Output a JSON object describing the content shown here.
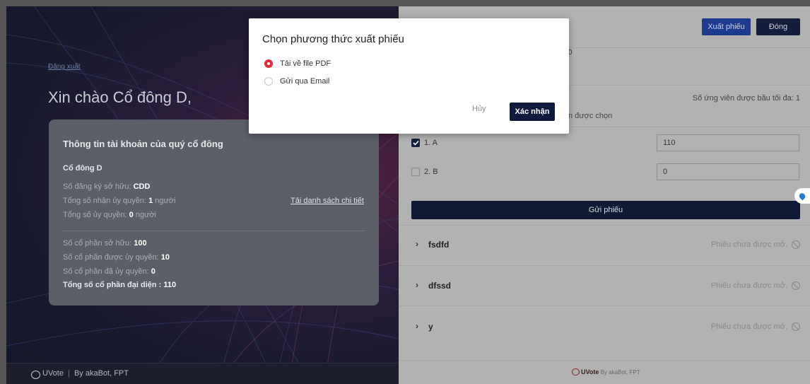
{
  "left_panel": {
    "logout": "Đăng xuất",
    "greeting": "Xin chào Cổ đông D,",
    "card": {
      "title": "Thông tin tài khoản của quý cổ đông",
      "shareholder_name": "Cổ đông D",
      "registration": {
        "label": "Số đăng ký sở hữu: ",
        "value": "CDD"
      },
      "received_proxies": {
        "label": "Tổng số nhận ủy quyền: ",
        "value": "1",
        "unit": " người"
      },
      "given_proxies": {
        "label": "Tổng số ủy quyền: ",
        "value": "0",
        "unit": " người"
      },
      "download_link": "Tải danh sách chi tiết",
      "owned_shares": {
        "label": "Số cổ phần sở hữu: ",
        "value": "100"
      },
      "proxied_shares": {
        "label": "Số cổ phần được ủy quyền: ",
        "value": "10"
      },
      "delegated_shares": {
        "label": "Số cổ phần đã ủy quyền: ",
        "value": "0"
      },
      "total_represented": {
        "label": "Tổng số cổ phần đại diện : ",
        "value": "110"
      }
    },
    "footer": {
      "brand": "UVote",
      "separator": "|",
      "by": "By akaBot, FPT"
    }
  },
  "right_panel": {
    "export_button": "Xuất phiếu",
    "close_button": "Đóng",
    "partial_zero": "0",
    "max_candidates": "Số ứng viên được bầu tối đa: 1",
    "chosen_fragment": "n được chọn",
    "candidates": [
      {
        "label": "1. A",
        "checked": true,
        "value": "110"
      },
      {
        "label": "2. B",
        "checked": false,
        "value": "0"
      }
    ],
    "submit_button": "Gửi phiếu",
    "sections": [
      {
        "chevron": "›",
        "name": "fsdfd",
        "status": "Phiếu chưa được mở."
      },
      {
        "chevron": "›",
        "name": "dfssd",
        "status": "Phiếu chưa được mở."
      },
      {
        "chevron": "›",
        "name": "y",
        "status": "Phiếu chưa được mở."
      }
    ],
    "footer": {
      "brand": "UVote",
      "by": " By akaBot, FPT"
    }
  },
  "modal": {
    "title": "Chọn phương thức xuất phiếu",
    "options": [
      {
        "label": "Tải về file PDF",
        "selected": true
      },
      {
        "label": "Gửi qua Email",
        "selected": false
      }
    ],
    "cancel": "Hủy",
    "confirm": "Xác nhận"
  },
  "colors": {
    "accent_red": "#e4283a",
    "navy": "#101a3e",
    "export_blue": "#1c3a8e"
  }
}
